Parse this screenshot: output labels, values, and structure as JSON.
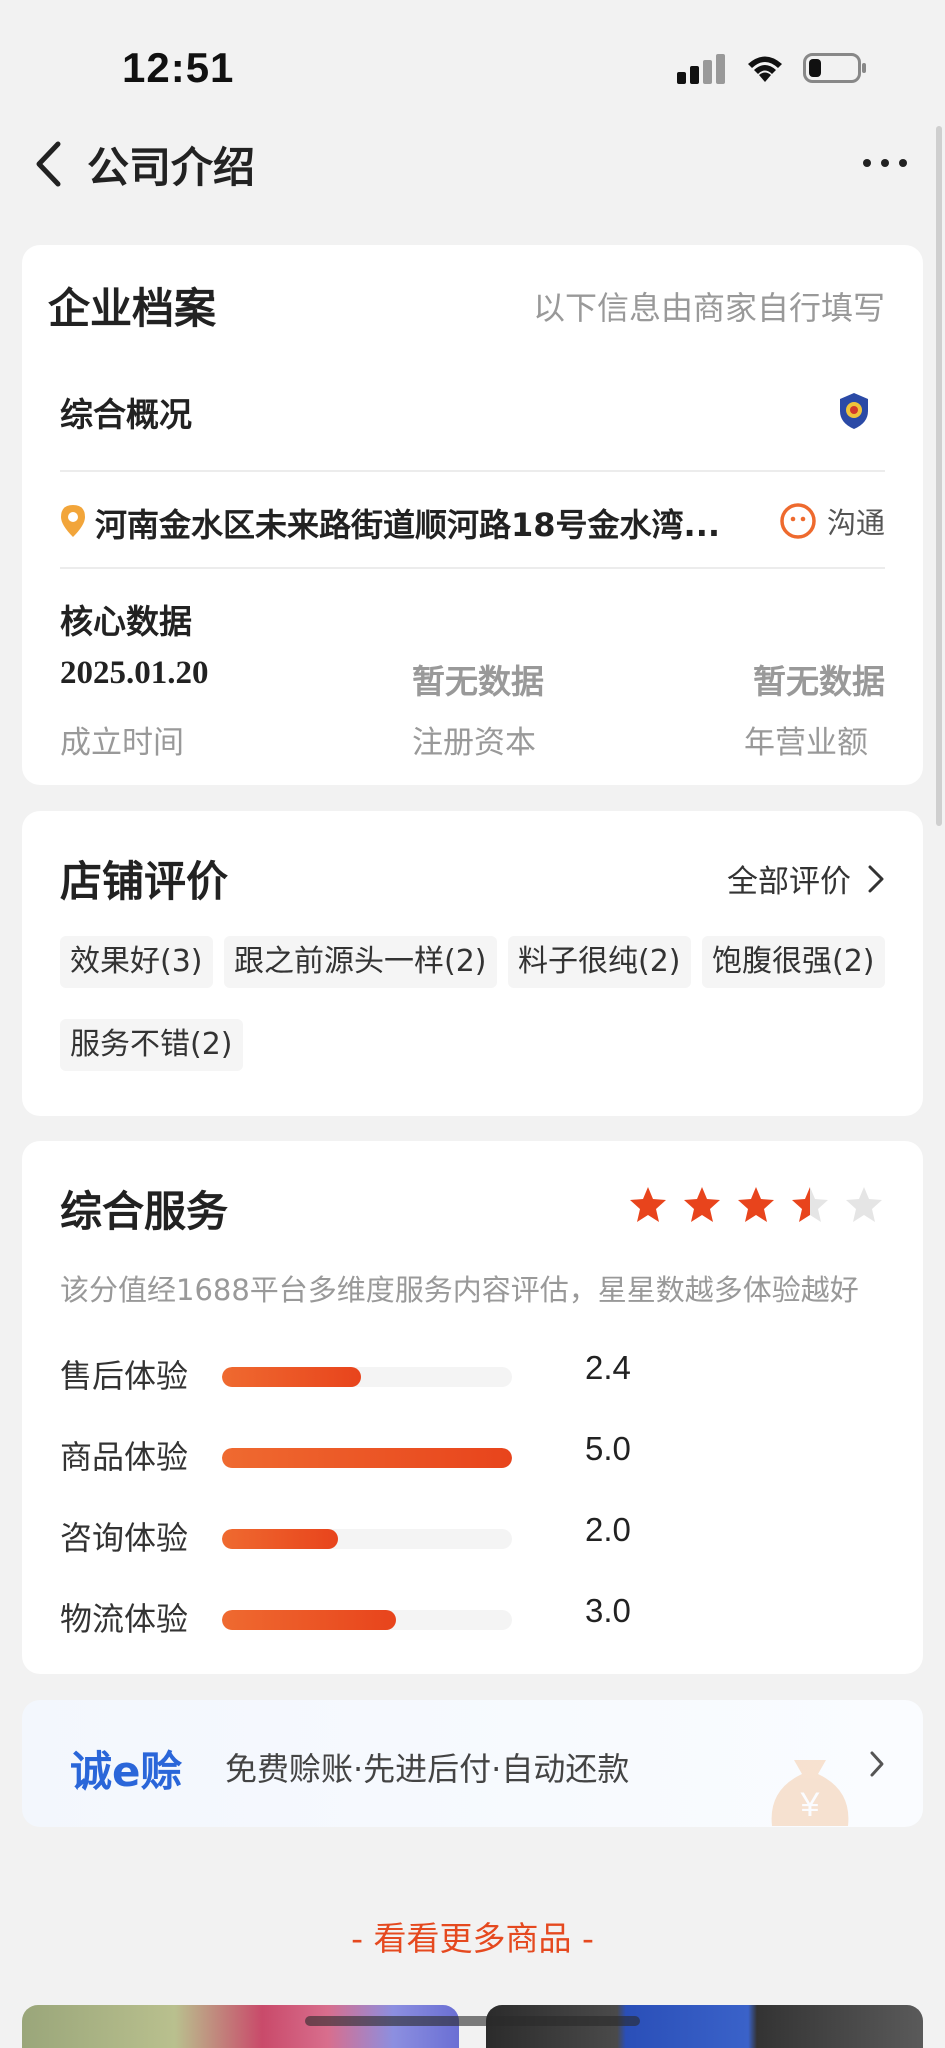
{
  "status_bar": {
    "time": "12:51"
  },
  "nav": {
    "title": "公司介绍"
  },
  "profile": {
    "title": "企业档案",
    "note": "以下信息由商家自行填写",
    "overview_label": "综合概况",
    "address": "河南金水区未来路街道顺河路18号金水湾...",
    "contact_label": "沟通",
    "core_title": "核心数据",
    "core": [
      {
        "value": "2025.01.20",
        "label": "成立时间"
      },
      {
        "value": "暂无数据",
        "label": "注册资本"
      },
      {
        "value": "暂无数据",
        "label": "年营业额"
      }
    ]
  },
  "reviews": {
    "title": "店铺评价",
    "all_label": "全部评价",
    "tags": [
      "效果好(3)",
      "跟之前源头一样(2)",
      "料子很纯(2)",
      "饱腹很强(2)",
      "服务不错(2)"
    ]
  },
  "service": {
    "title": "综合服务",
    "stars": 3.5,
    "desc": "该分值经1688平台多维度服务内容评估，星星数越多体验越好",
    "rows": [
      {
        "label": "售后体验",
        "value": "2.4",
        "score": 2.4
      },
      {
        "label": "商品体验",
        "value": "5.0",
        "score": 5.0
      },
      {
        "label": "咨询体验",
        "value": "2.0",
        "score": 2.0
      },
      {
        "label": "物流体验",
        "value": "3.0",
        "score": 3.0
      }
    ]
  },
  "banner": {
    "brand": "诚e赊",
    "text": "免费赊账·先进后付·自动还款"
  },
  "more": {
    "label": "- 看看更多商品 -"
  },
  "colors": {
    "accent": "#e8441c",
    "brand_blue": "#2a66d9",
    "star_off": "#e5e5e5"
  }
}
